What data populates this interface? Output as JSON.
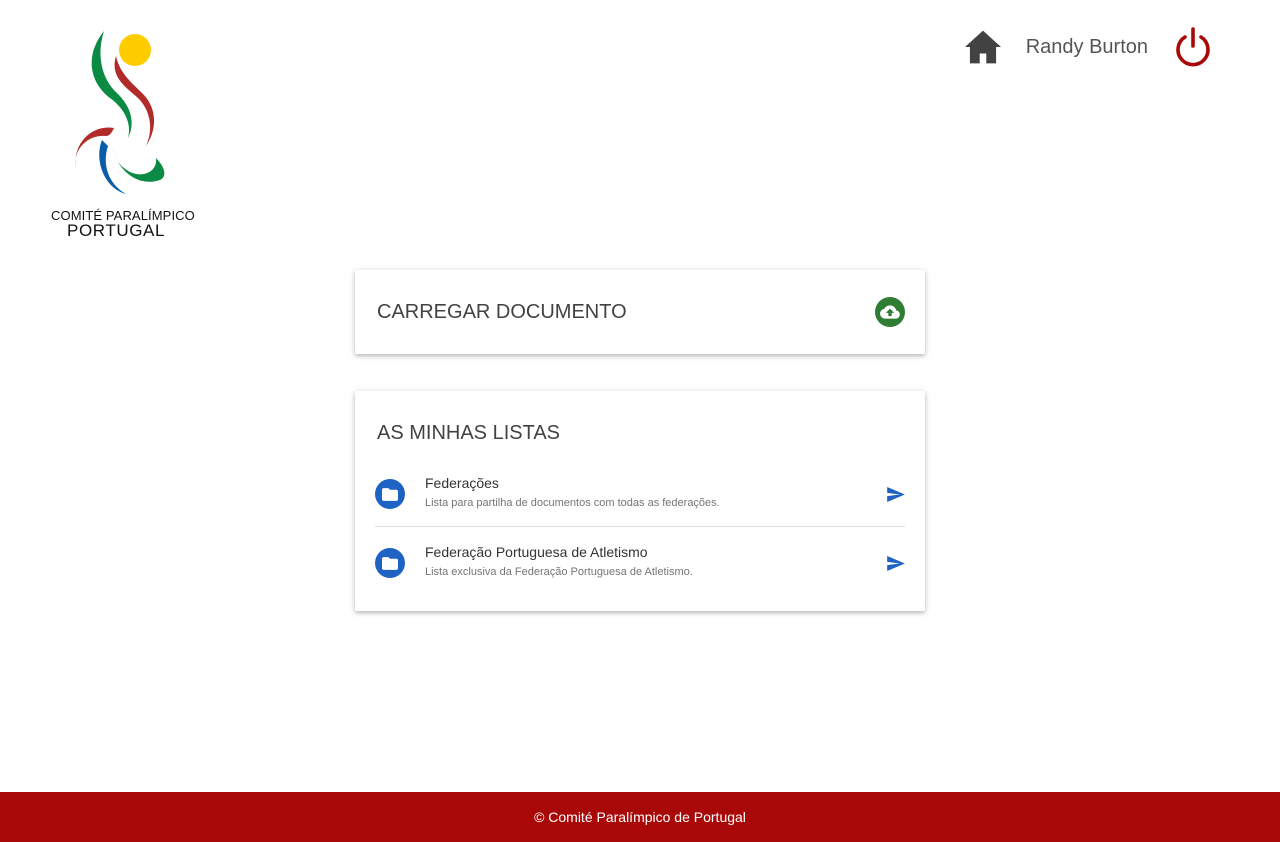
{
  "logo": {
    "line1": "COMITÉ PARALÍMPICO",
    "line2": "PORTUGAL"
  },
  "header": {
    "user_name": "Randy Burton",
    "home_icon": "home-icon",
    "power_icon": "power-icon"
  },
  "upload_card": {
    "title": "CARREGAR DOCUMENTO",
    "icon": "cloud-upload-icon"
  },
  "lists_card": {
    "title": "AS MINHAS LISTAS",
    "items": [
      {
        "title": "Federações",
        "subtitle": "Lista para partilha de documentos com todas as federações.",
        "icon": "folder-icon",
        "action_icon": "send-icon"
      },
      {
        "title": "Federação Portuguesa de Atletismo",
        "subtitle": "Lista exclusiva da Federação Portuguesa de Atletismo.",
        "icon": "folder-icon",
        "action_icon": "send-icon"
      }
    ]
  },
  "footer": {
    "text": "© Comité Paralímpico de Portugal"
  },
  "colors": {
    "brand_red": "#a80808",
    "upload_green": "#2e7d32",
    "folder_blue": "#1e63c4",
    "logo_yellow": "#ffcc00",
    "logo_green": "#0b8a44",
    "logo_red": "#b22b2b",
    "logo_blue": "#0b5da8"
  }
}
